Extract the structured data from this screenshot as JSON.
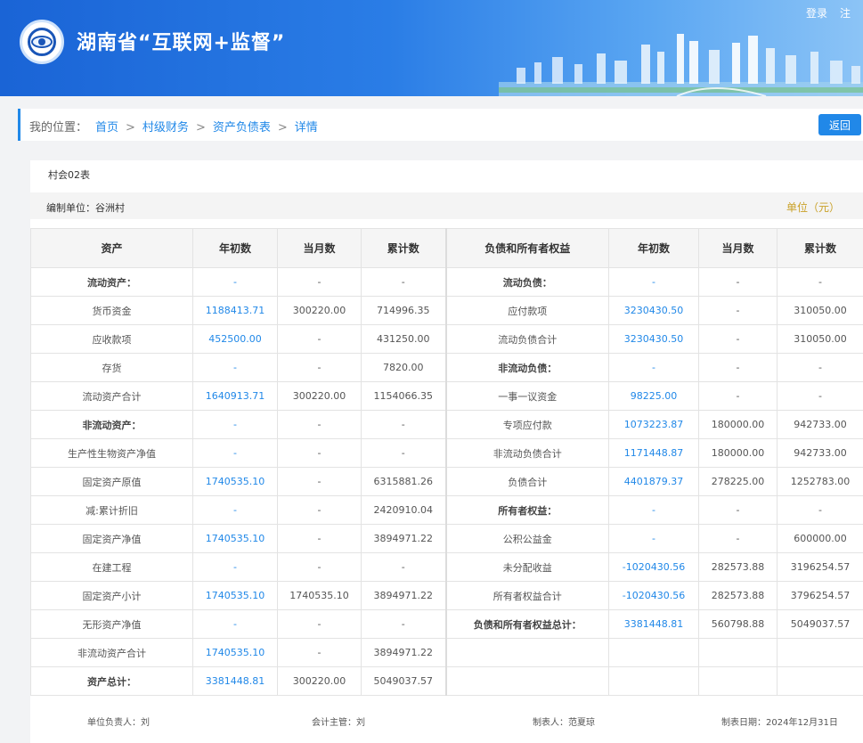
{
  "header": {
    "site_title": "湖南省“互联网+监督”",
    "links": [
      "登录",
      "注"
    ]
  },
  "breadcrumb": {
    "label": "我的位置：",
    "items": [
      "首页",
      "村级财务",
      "资产负债表",
      "详情"
    ],
    "back_label": "返回"
  },
  "report": {
    "form_no": "村会02表",
    "unit_name": "编制单位：谷洲村",
    "unit_measure": "单位（元）",
    "headers": [
      "资产",
      "年初数",
      "当月数",
      "累计数",
      "负债和所有者权益",
      "年初数",
      "当月数",
      "累计数"
    ],
    "rows": [
      [
        "流动资产：",
        "-",
        "-",
        "-",
        "流动负债：",
        "-",
        "-",
        "-"
      ],
      [
        "货币资金",
        "1188413.71",
        "300220.00",
        "714996.35",
        "应付款项",
        "3230430.50",
        "-",
        "310050.00"
      ],
      [
        "应收款项",
        "452500.00",
        "-",
        "431250.00",
        "流动负债合计",
        "3230430.50",
        "-",
        "310050.00"
      ],
      [
        "存货",
        "-",
        "-",
        "7820.00",
        "非流动负债：",
        "-",
        "-",
        "-"
      ],
      [
        "流动资产合计",
        "1640913.71",
        "300220.00",
        "1154066.35",
        "一事一议资金",
        "98225.00",
        "-",
        "-"
      ],
      [
        "非流动资产：",
        "-",
        "-",
        "-",
        "专项应付款",
        "1073223.87",
        "180000.00",
        "942733.00"
      ],
      [
        "生产性生物资产净值",
        "-",
        "-",
        "-",
        "非流动负债合计",
        "1171448.87",
        "180000.00",
        "942733.00"
      ],
      [
        "固定资产原值",
        "1740535.10",
        "-",
        "6315881.26",
        "负债合计",
        "4401879.37",
        "278225.00",
        "1252783.00"
      ],
      [
        "减:累计折旧",
        "-",
        "-",
        "2420910.04",
        "所有者权益：",
        "-",
        "-",
        "-"
      ],
      [
        "固定资产净值",
        "1740535.10",
        "-",
        "3894971.22",
        "公积公益金",
        "-",
        "-",
        "600000.00"
      ],
      [
        "在建工程",
        "-",
        "-",
        "-",
        "未分配收益",
        "-1020430.56",
        "282573.88",
        "3196254.57"
      ],
      [
        "固定资产小计",
        "1740535.10",
        "1740535.10",
        "3894971.22",
        "所有者权益合计",
        "-1020430.56",
        "282573.88",
        "3796254.57"
      ],
      [
        "无形资产净值",
        "-",
        "-",
        "-",
        "负债和所有者权益总计：",
        "3381448.81",
        "560798.88",
        "5049037.57"
      ],
      [
        "非流动资产合计",
        "1740535.10",
        "-",
        "3894971.22",
        "",
        "",
        "",
        ""
      ],
      [
        "资产总计：",
        "3381448.81",
        "300220.00",
        "5049037.57",
        "",
        "",
        "",
        ""
      ]
    ],
    "bold_left_rows": [
      0,
      5,
      14
    ],
    "bold_right_rows": [
      0,
      3,
      8,
      12
    ]
  },
  "signatures": {
    "head": "单位负责人：刘",
    "accountant": "会计主管：刘",
    "preparer": "制表人：范夏琼",
    "date": "制表日期：2024年12月31日"
  },
  "colors": {
    "accent": "#2188e8",
    "unit_text": "#c9a128"
  }
}
